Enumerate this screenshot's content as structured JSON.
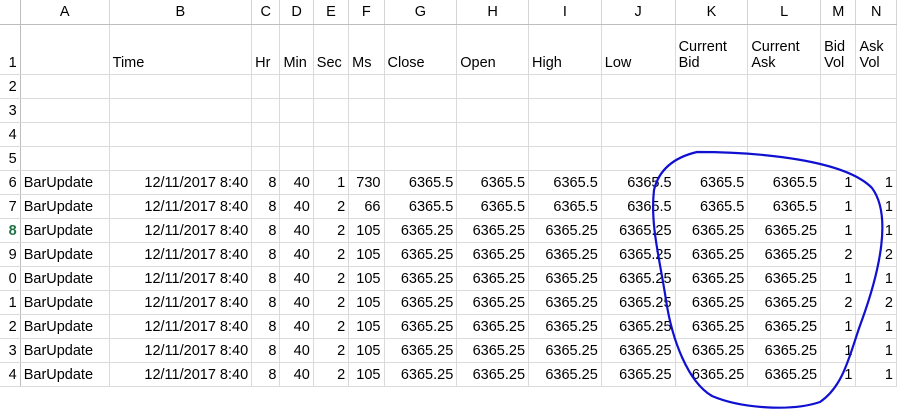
{
  "columns": [
    "A",
    "B",
    "C",
    "D",
    "E",
    "F",
    "G",
    "H",
    "I",
    "J",
    "K",
    "L",
    "M",
    "N"
  ],
  "header_row": {
    "row_num": "1",
    "cells": [
      "",
      "Time",
      "Hr",
      "Min",
      "Sec",
      "Ms",
      "Close",
      "Open",
      "High",
      "Low",
      "Current Bid",
      "Current Ask",
      "Bid Vol",
      "Ask Vol"
    ]
  },
  "empty_rows": [
    "2",
    "3",
    "4",
    "5"
  ],
  "data_rows": [
    {
      "row_num": "6",
      "cells": [
        "BarUpdate",
        "12/11/2017 8:40",
        "8",
        "40",
        "1",
        "730",
        "6365.5",
        "6365.5",
        "6365.5",
        "6365.5",
        "6365.5",
        "6365.5",
        "1",
        "1"
      ]
    },
    {
      "row_num": "7",
      "cells": [
        "BarUpdate",
        "12/11/2017 8:40",
        "8",
        "40",
        "2",
        "66",
        "6365.5",
        "6365.5",
        "6365.5",
        "6365.5",
        "6365.5",
        "6365.5",
        "1",
        "1"
      ]
    },
    {
      "row_num": "8",
      "cells": [
        "BarUpdate",
        "12/11/2017 8:40",
        "8",
        "40",
        "2",
        "105",
        "6365.25",
        "6365.25",
        "6365.25",
        "6365.25",
        "6365.25",
        "6365.25",
        "1",
        "1"
      ]
    },
    {
      "row_num": "9",
      "cells": [
        "BarUpdate",
        "12/11/2017 8:40",
        "8",
        "40",
        "2",
        "105",
        "6365.25",
        "6365.25",
        "6365.25",
        "6365.25",
        "6365.25",
        "6365.25",
        "2",
        "2"
      ]
    },
    {
      "row_num": "0",
      "cells": [
        "BarUpdate",
        "12/11/2017 8:40",
        "8",
        "40",
        "2",
        "105",
        "6365.25",
        "6365.25",
        "6365.25",
        "6365.25",
        "6365.25",
        "6365.25",
        "1",
        "1"
      ]
    },
    {
      "row_num": "1",
      "cells": [
        "BarUpdate",
        "12/11/2017 8:40",
        "8",
        "40",
        "2",
        "105",
        "6365.25",
        "6365.25",
        "6365.25",
        "6365.25",
        "6365.25",
        "6365.25",
        "2",
        "2"
      ]
    },
    {
      "row_num": "2",
      "cells": [
        "BarUpdate",
        "12/11/2017 8:40",
        "8",
        "40",
        "2",
        "105",
        "6365.25",
        "6365.25",
        "6365.25",
        "6365.25",
        "6365.25",
        "6365.25",
        "1",
        "1"
      ]
    },
    {
      "row_num": "3",
      "cells": [
        "BarUpdate",
        "12/11/2017 8:40",
        "8",
        "40",
        "2",
        "105",
        "6365.25",
        "6365.25",
        "6365.25",
        "6365.25",
        "6365.25",
        "6365.25",
        "1",
        "1"
      ]
    },
    {
      "row_num": "4",
      "cells": [
        "BarUpdate",
        "12/11/2017 8:40",
        "8",
        "40",
        "2",
        "105",
        "6365.25",
        "6365.25",
        "6365.25",
        "6365.25",
        "6365.25",
        "6365.25",
        "1",
        "1"
      ]
    }
  ],
  "selected_row": "8",
  "annotation_color": "#1010d0"
}
